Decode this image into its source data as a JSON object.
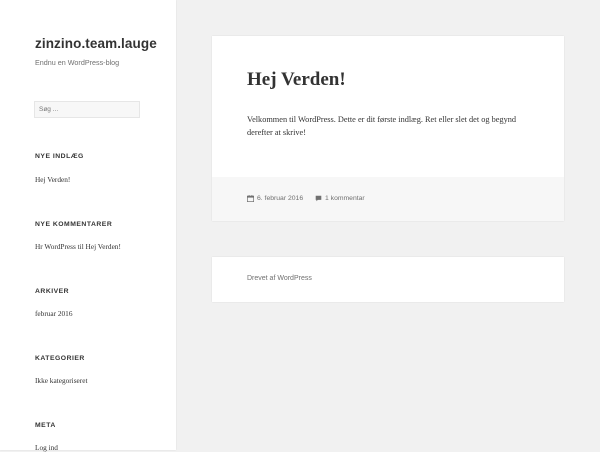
{
  "site": {
    "title": "zinzino.team.lauge",
    "description": "Endnu en WordPress-blog"
  },
  "search": {
    "placeholder": "Søg ..."
  },
  "widgets": {
    "recent_posts": {
      "title": "NYE INDLÆG",
      "items": [
        "Hej Verden!"
      ]
    },
    "recent_comments": {
      "title": "NYE KOMMENTARER",
      "items": [
        "Hr WordPress til Hej Verden!"
      ]
    },
    "archives": {
      "title": "ARKIVER",
      "items": [
        "februar 2016"
      ]
    },
    "categories": {
      "title": "KATEGORIER",
      "items": [
        "Ikke kategoriseret"
      ]
    },
    "meta": {
      "title": "META",
      "items": [
        "Log ind"
      ]
    }
  },
  "post": {
    "title": "Hej Verden!",
    "body": "Velkommen til WordPress. Dette er dit første indlæg. Ret eller slet det og begynd derefter at skrive!",
    "date": "6. februar 2016",
    "comments": "1 kommentar"
  },
  "footer": {
    "powered_by": "Drevet af WordPress"
  },
  "icons": {
    "calendar": "calendar-icon",
    "comment": "comment-bubble-icon"
  },
  "colors": {
    "background": "#f1f1f1",
    "panel": "#ffffff",
    "footer_strip": "#f7f7f7",
    "text": "#333333",
    "muted": "#707070"
  }
}
